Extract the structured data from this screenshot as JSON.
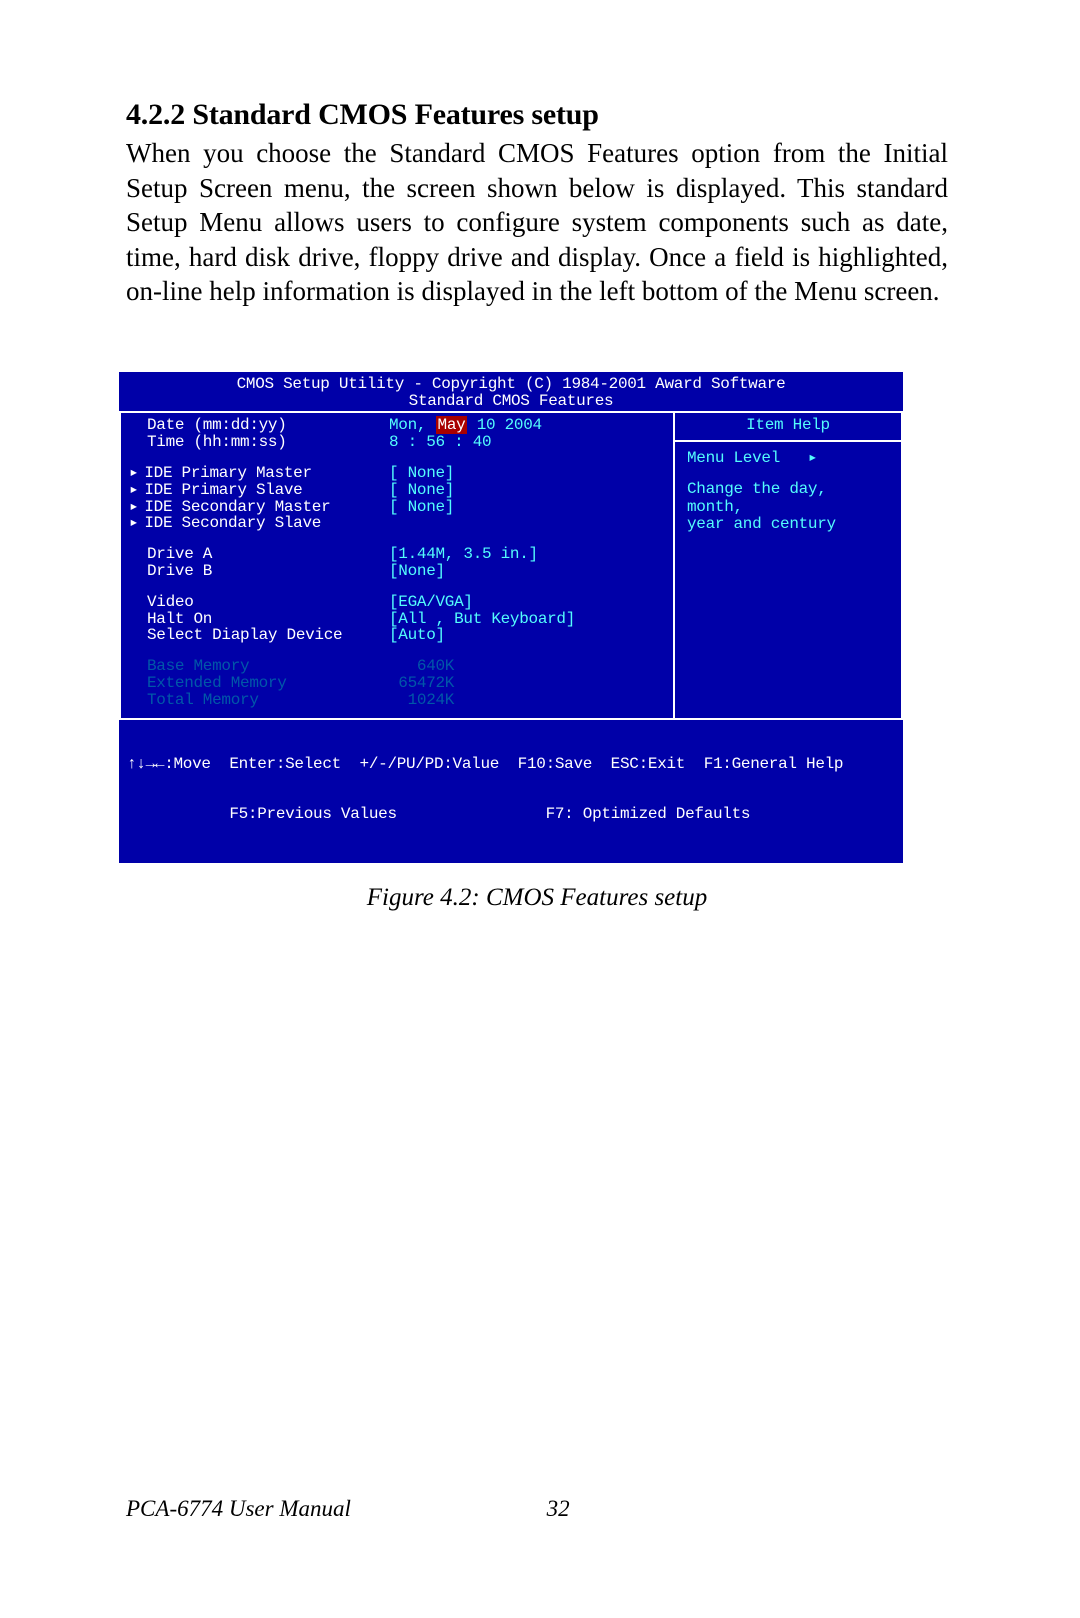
{
  "section": {
    "num": "4.2.2",
    "title": "Standard CMOS Features setup"
  },
  "paragraph": "When you choose the Standard CMOS Features option from the Initial Setup Screen menu, the screen shown below is displayed. This standard Setup Menu allows users to configure system components such as date, time, hard disk drive, floppy drive and display. Once a field is highlighted, on-line help information is displayed in the left bottom of the Menu screen.",
  "bios": {
    "title1": "CMOS Setup Utility - Copyright (C) 1984-2001 Award Software",
    "title2": "Standard CMOS Features",
    "date_label": "Date (mm:dd:yy)",
    "date_prefix": "Mon, ",
    "date_sel": "May",
    "date_suffix": " 10 2004",
    "time_label": "Time (hh:mm:ss)",
    "time_value": "8 : 56 : 40",
    "ide_pm": "IDE Primary Master",
    "ide_pm_v": "[ None]",
    "ide_ps": "IDE Primary Slave",
    "ide_ps_v": "[ None]",
    "ide_sm": "IDE Secondary Master",
    "ide_sm_v": "[ None]",
    "ide_ss": "IDE Secondary Slave",
    "drive_a": "Drive A",
    "drive_a_v": "[1.44M, 3.5 in.]",
    "drive_b": "Drive B",
    "drive_b_v": "[None]",
    "video": "Video",
    "video_v": "[EGA/VGA]",
    "halt": "Halt On",
    "halt_v": "[All , But Keyboard]",
    "disp": "Select Diaplay Device",
    "disp_v": "[Auto]",
    "base": "Base Memory",
    "base_v": "   640K",
    "ext": "Extended Memory",
    "ext_v": " 65472K",
    "total": "Total Memory",
    "total_v": "  1024K",
    "help_title": "Item Help",
    "menulevel": "Menu Level   ▸",
    "help1": "Change the day, month,",
    "help2": "year and century",
    "footer1": "↑↓→←:Move  Enter:Select  +/-/PU/PD:Value  F10:Save  ESC:Exit  F1:General Help",
    "footer2": "           F5:Previous Values                F7: Optimized Defaults"
  },
  "figcap": "Figure 4.2: CMOS Features setup",
  "footer_doc": "PCA-6774 User Manual",
  "footer_page": "32"
}
